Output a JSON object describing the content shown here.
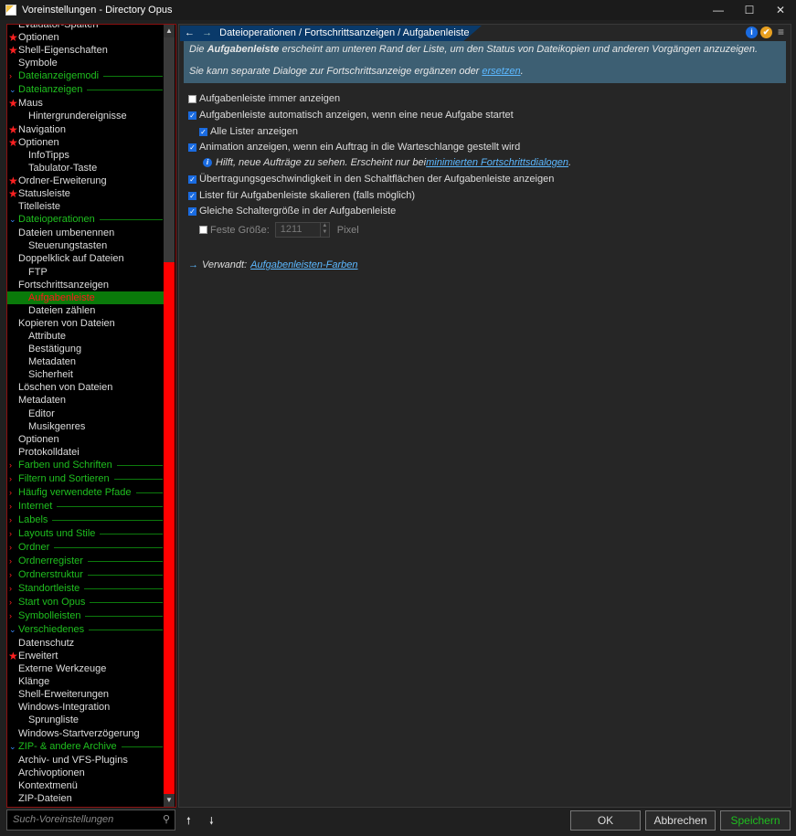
{
  "window": {
    "title": "Voreinstellungen - Directory Opus",
    "minimize": "—",
    "maximize": "☐",
    "close": "✕"
  },
  "sidebar": {
    "items": [
      {
        "label": "Evaluator-Spalten",
        "type": "item",
        "level": 1
      },
      {
        "label": "Optionen",
        "type": "item",
        "level": 1,
        "star": true
      },
      {
        "label": "Shell-Eigenschaften",
        "type": "item",
        "level": 1,
        "star": true
      },
      {
        "label": "Symbole",
        "type": "item",
        "level": 1
      },
      {
        "label": "Dateianzeigemodi",
        "type": "category",
        "expanded": false
      },
      {
        "label": "Dateianzeigen",
        "type": "category",
        "expanded": true
      },
      {
        "label": "Maus",
        "type": "item",
        "level": 1,
        "star": true
      },
      {
        "label": "Hintergrundereignisse",
        "type": "item",
        "level": 2
      },
      {
        "label": "Navigation",
        "type": "item",
        "level": 1,
        "star": true
      },
      {
        "label": "Optionen",
        "type": "item",
        "level": 1,
        "star": true
      },
      {
        "label": "InfoTipps",
        "type": "item",
        "level": 2
      },
      {
        "label": "Tabulator-Taste",
        "type": "item",
        "level": 2
      },
      {
        "label": "Ordner-Erweiterung",
        "type": "item",
        "level": 1,
        "star": true
      },
      {
        "label": "Statusleiste",
        "type": "item",
        "level": 1,
        "star": true
      },
      {
        "label": "Titelleiste",
        "type": "item",
        "level": 1
      },
      {
        "label": "Dateioperationen",
        "type": "category",
        "expanded": true
      },
      {
        "label": "Dateien umbenennen",
        "type": "item",
        "level": 1
      },
      {
        "label": "Steuerungstasten",
        "type": "item",
        "level": 2
      },
      {
        "label": "Doppelklick auf Dateien",
        "type": "item",
        "level": 1
      },
      {
        "label": "FTP",
        "type": "item",
        "level": 2
      },
      {
        "label": "Fortschrittsanzeigen",
        "type": "item",
        "level": 1
      },
      {
        "label": "Aufgabenleiste",
        "type": "item",
        "level": 2,
        "selected": true
      },
      {
        "label": "Dateien zählen",
        "type": "item",
        "level": 2
      },
      {
        "label": "Kopieren von Dateien",
        "type": "item",
        "level": 1
      },
      {
        "label": "Attribute",
        "type": "item",
        "level": 2
      },
      {
        "label": "Bestätigung",
        "type": "item",
        "level": 2
      },
      {
        "label": "Metadaten",
        "type": "item",
        "level": 2
      },
      {
        "label": "Sicherheit",
        "type": "item",
        "level": 2
      },
      {
        "label": "Löschen von Dateien",
        "type": "item",
        "level": 1
      },
      {
        "label": "Metadaten",
        "type": "item",
        "level": 1
      },
      {
        "label": "Editor",
        "type": "item",
        "level": 2
      },
      {
        "label": "Musikgenres",
        "type": "item",
        "level": 2
      },
      {
        "label": "Optionen",
        "type": "item",
        "level": 1
      },
      {
        "label": "Protokolldatei",
        "type": "item",
        "level": 1
      },
      {
        "label": "Farben und Schriften",
        "type": "category",
        "expanded": false
      },
      {
        "label": "Filtern und Sortieren",
        "type": "category",
        "expanded": false
      },
      {
        "label": "Häufig verwendete Pfade",
        "type": "category",
        "expanded": false
      },
      {
        "label": "Internet",
        "type": "category",
        "expanded": false
      },
      {
        "label": "Labels",
        "type": "category",
        "expanded": false
      },
      {
        "label": "Layouts und Stile",
        "type": "category",
        "expanded": false
      },
      {
        "label": "Ordner",
        "type": "category",
        "expanded": false
      },
      {
        "label": "Ordnerregister",
        "type": "category",
        "expanded": false
      },
      {
        "label": "Ordnerstruktur",
        "type": "category",
        "expanded": false
      },
      {
        "label": "Standortleiste",
        "type": "category",
        "expanded": false
      },
      {
        "label": "Start von Opus",
        "type": "category",
        "expanded": false
      },
      {
        "label": "Symbolleisten",
        "type": "category",
        "expanded": false
      },
      {
        "label": "Verschiedenes",
        "type": "category",
        "expanded": true
      },
      {
        "label": "Datenschutz",
        "type": "item",
        "level": 1
      },
      {
        "label": "Erweitert",
        "type": "item",
        "level": 1,
        "star": true
      },
      {
        "label": "Externe Werkzeuge",
        "type": "item",
        "level": 1
      },
      {
        "label": "Klänge",
        "type": "item",
        "level": 1
      },
      {
        "label": "Shell-Erweiterungen",
        "type": "item",
        "level": 1
      },
      {
        "label": "Windows-Integration",
        "type": "item",
        "level": 1
      },
      {
        "label": "Sprungliste",
        "type": "item",
        "level": 2
      },
      {
        "label": "Windows-Startverzögerung",
        "type": "item",
        "level": 1
      },
      {
        "label": "ZIP- & andere Archive",
        "type": "category",
        "expanded": true
      },
      {
        "label": "Archiv- und VFS-Plugins",
        "type": "item",
        "level": 1
      },
      {
        "label": "Archivoptionen",
        "type": "item",
        "level": 1
      },
      {
        "label": "Kontextmenü",
        "type": "item",
        "level": 1
      },
      {
        "label": "ZIP-Dateien",
        "type": "item",
        "level": 1
      }
    ],
    "search_placeholder": "Such-Voreinstellungen"
  },
  "header": {
    "back": "←",
    "forward": "→",
    "breadcrumb": "Dateioperationen / Fortschrittsanzeigen / Aufgabenleiste",
    "info_icon": "i",
    "check_icon": "✔",
    "menu_icon": "≡"
  },
  "info": {
    "line1_pre": "Die ",
    "line1_bold": "Aufgabenleiste",
    "line1_post": " erscheint am unteren Rand der Liste, um den Status von Dateikopien und anderen Vorgängen anzuzeigen.",
    "line2_pre": "Sie kann separate Dialoge zur Fortschrittsanzeige ergänzen oder ",
    "line2_link": "ersetzen",
    "line2_post": "."
  },
  "options": [
    {
      "label": "Aufgabenleiste immer anzeigen",
      "checked": false
    },
    {
      "label": "Aufgabenleiste automatisch anzeigen, wenn eine neue Aufgabe startet",
      "checked": true
    },
    {
      "label": "Alle Lister anzeigen",
      "checked": true
    },
    {
      "label": "Animation anzeigen, wenn ein Auftrag in die Warteschlange gestellt wird",
      "checked": true
    },
    {
      "label": "Übertragungsgeschwindigkeit in den Schaltflächen der Aufgabenleiste anzeigen",
      "checked": true
    },
    {
      "label": "Lister für Aufgabenleiste skalieren (falls möglich)",
      "checked": true
    },
    {
      "label": "Gleiche Schaltergröße in der Aufgabenleiste",
      "checked": true
    },
    {
      "label": "Feste Größe:",
      "checked": false
    }
  ],
  "hint": {
    "pre": "Hilft, neue Aufträge zu sehen. Erscheint nur bei ",
    "link": "minimierten Fortschrittsdialogen",
    "post": "."
  },
  "fixed_size": {
    "value": "1211",
    "unit": "Pixel"
  },
  "related": {
    "arrow": "→",
    "label": "Verwandt:",
    "link": "Aufgabenleisten-Farben"
  },
  "footer": {
    "up": "🠕",
    "down": "🠗",
    "ok": "OK",
    "cancel": "Abbrechen",
    "save": "Speichern"
  },
  "colors": {
    "category": "#1fbf1f",
    "selected_bg": "#0a7a0a",
    "selected_text": "#ff1818",
    "star": "#ff2020",
    "accent": "#1a6be0"
  }
}
